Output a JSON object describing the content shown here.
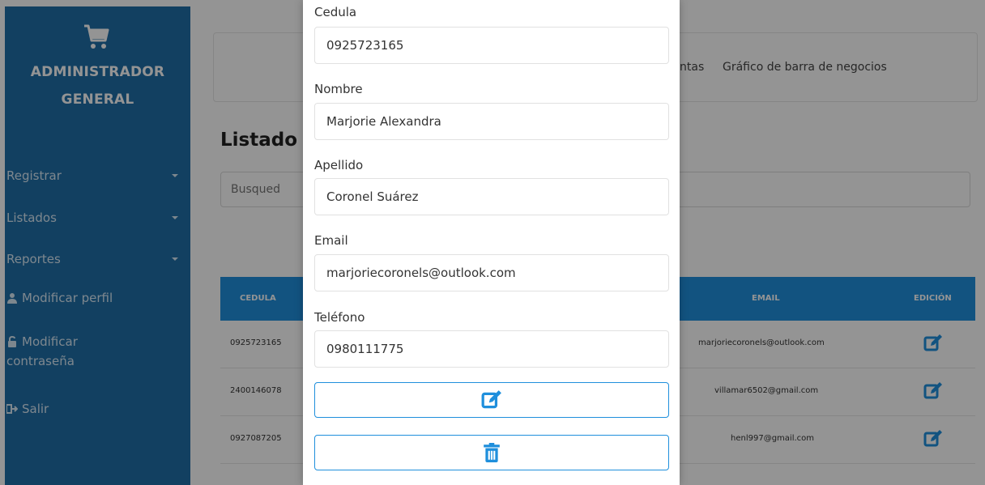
{
  "sidebar": {
    "brand_line1": "ADMINISTRADOR",
    "brand_line2": "GENERAL",
    "logo_icon": "cart-icon",
    "items": [
      {
        "label": "Registrar"
      },
      {
        "label": "Listados"
      },
      {
        "label": "Reportes"
      },
      {
        "label": "Modificar perfil",
        "icon": "user-icon"
      },
      {
        "label_line1": "Modificar",
        "label_line2": "contraseña",
        "icon": "lock-icon"
      },
      {
        "label": "Salir",
        "icon": "sign-out-icon"
      }
    ]
  },
  "top_nav": {
    "link_partial": "ntas",
    "link_chart": "Gráfico de barra de negocios"
  },
  "main": {
    "title_partial": "Listado",
    "search_placeholder_partial": "Busqued"
  },
  "table": {
    "headers": {
      "cedula": "CEDULA",
      "email": "EMAIL",
      "edicion": "EDICIÓN"
    },
    "rows": [
      {
        "cedula": "0925723165",
        "email": "marjoriecoronels@outlook.com"
      },
      {
        "cedula": "2400146078",
        "email": "villamar6502@gmail.com"
      },
      {
        "cedula": "0927087205",
        "email": "henl997@gmail.com"
      }
    ]
  },
  "modal": {
    "fields": [
      {
        "label": "Cedula",
        "value": "0925723165"
      },
      {
        "label": "Nombre",
        "value": "Marjorie Alexandra"
      },
      {
        "label": "Apellido",
        "value": "Coronel Suárez"
      },
      {
        "label": "Email",
        "value": "marjoriecoronels@outlook.com"
      },
      {
        "label": "Teléfono",
        "value": "0980111775"
      }
    ],
    "edit_icon": "edit-icon",
    "delete_icon": "trash-icon"
  },
  "colors": {
    "sidebar": "#1f6ea8",
    "accent": "#1f8fdc"
  }
}
